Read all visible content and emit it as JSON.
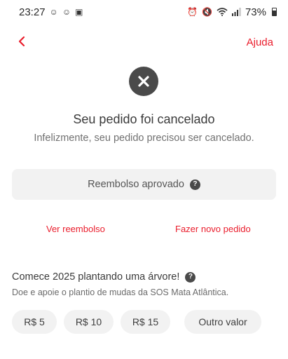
{
  "status_bar": {
    "time": "23:27",
    "left_icons": [
      "notification-icon",
      "notification-icon",
      "notification-icon"
    ],
    "right_icons": [
      "alarm-icon",
      "mute-icon",
      "wifi-icon",
      "signal-icon",
      "battery-icon"
    ],
    "battery": "73%"
  },
  "header": {
    "back_icon": "chevron-left-icon",
    "help_label": "Ajuda"
  },
  "status": {
    "icon": "cancel-circle-icon",
    "title": "Seu pedido foi cancelado",
    "subtitle": "Infelizmente, seu pedido precisou ser cancelado."
  },
  "refund": {
    "label": "Reembolso aprovado",
    "help_icon": "question-icon"
  },
  "actions": {
    "view_refund": "Ver reembolso",
    "new_order": "Fazer novo pedido"
  },
  "donation": {
    "title": "Comece 2025 plantando uma árvore!",
    "subtitle": "Doe e apoie o plantio de mudas da SOS Mata Atlântica.",
    "options": [
      "R$ 5",
      "R$ 10",
      "R$ 15",
      "Outro valor"
    ]
  },
  "colors": {
    "accent": "#ea1d2c",
    "chip_bg": "#f2f2f2",
    "icon_dark": "#4a4a4a"
  }
}
